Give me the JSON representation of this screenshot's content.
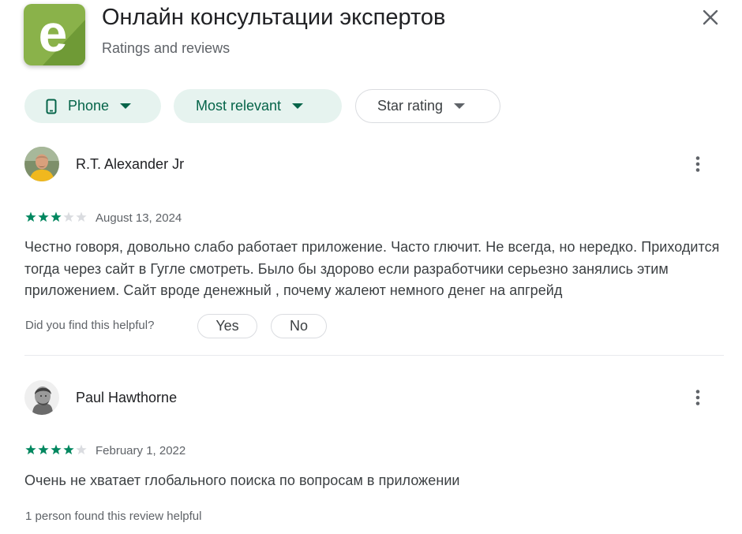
{
  "app": {
    "title": "Онлайн консультации экспертов",
    "subtitle": "Ratings and reviews",
    "icon_letter": "e",
    "icon_colors": {
      "background": "#8ab24a",
      "shade": "#5f8a2e"
    }
  },
  "filters": {
    "device": {
      "label": "Phone",
      "icon": "phone-icon",
      "selected": true
    },
    "sort": {
      "label": "Most relevant",
      "selected": true
    },
    "rating": {
      "label": "Star rating",
      "selected": false
    }
  },
  "colors": {
    "accent": "#01875f",
    "chip_selected_bg": "#e6f3ef",
    "chip_selected_text": "#056449",
    "star_empty": "#dadce0"
  },
  "reviews": [
    {
      "author": "R.T. Alexander Jr",
      "avatar_icon": "user-avatar-yellow-shirt",
      "rating": 3,
      "max_rating": 5,
      "date": "August 13, 2024",
      "text": "Честно говоря, довольно слабо работает приложение. Часто глючит. Не всегда, но нередко. Приходится тогда через сайт в Гугле смотреть. Было бы здорово если разработчики серьезно занялись этим приложением. Сайт вроде денежный , почему жалеют немного денег на апгрейд",
      "helpful_question": "Did you find this helpful?",
      "yes_label": "Yes",
      "no_label": "No"
    },
    {
      "author": "Paul Hawthorne",
      "avatar_icon": "user-avatar-engraving",
      "rating": 4,
      "max_rating": 5,
      "date": "February 1, 2022",
      "text": "Очень не хватает глобального поиска по вопросам в приложении",
      "helpful_count_text": "1 person found this review helpful"
    }
  ]
}
